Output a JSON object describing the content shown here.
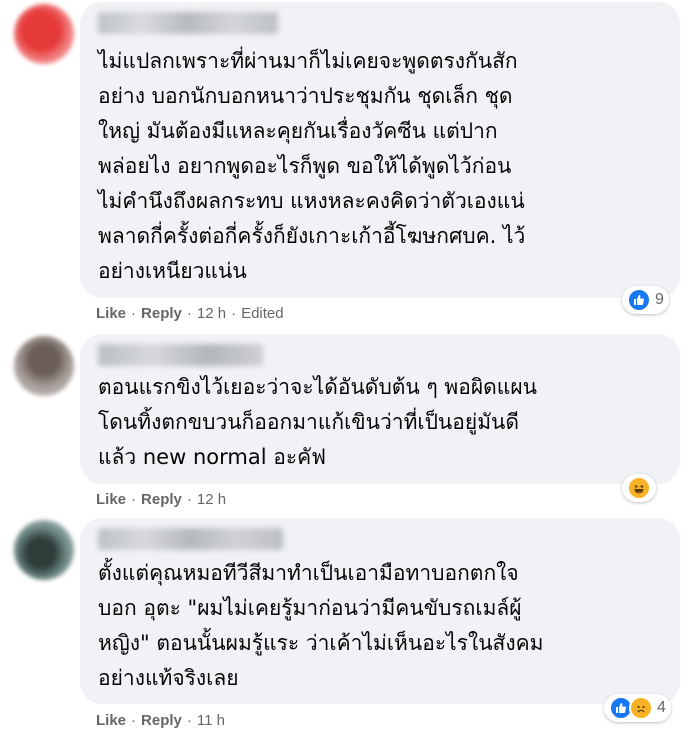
{
  "actions": {
    "like": "Like",
    "reply": "Reply",
    "separator": "·"
  },
  "comments": [
    {
      "text": "ไม่แปลกเพราะที่ผ่านมาก็ไม่เคยจะพูดตรงกันสัก\nอย่าง บอกนักบอกหนาว่าประชุมกัน ชุดเล็ก ชุด\nใหญ่ มันต้องมีแหละคุยกันเรื่องวัคซีน แต่ปาก\nพล่อยไง อยากพูดอะไรก็พูด ขอให้ได้พูดไว้ก่อน\nไม่คำนึงถึงผลกระทบ แหงหละคงคิดว่าตัวเองแน่\nพลาดกี่ครั้งต่อกี่ครั้งก็ยังเกาะเก้าอี้โฆษกศบค. ไว้\nอย่างเหนียวแน่น",
      "time": "12 h",
      "edited": "Edited",
      "reaction_count": "9",
      "reactions": [
        "like-icon"
      ]
    },
    {
      "text": "ตอนแรกขิงไว้เยอะว่าจะได้อันดับต้น ๆ พอผิดแผน\nโดนทิ้งตกขบวนก็ออกมาแก้เขินว่าที่เป็นอยู่มันดี\nแล้ว new normal อะคัฟ",
      "time": "12 h",
      "reactions": [
        "haha-icon"
      ]
    },
    {
      "text": "ตั้งแต่คุณหมอทีวีสีมาทำเป็นเอามือทาบอกตกใจ\nบอก อุตะ \"ผมไม่เคยรู้มาก่อนว่ามีคนขับรถเมล์ผู้\nหญิง\" ตอนนั้นผมรู้แระ ว่าเค้าไม่เห็นอะไรในสังคม\nอย่างแท้จริงเลย",
      "time": "11 h",
      "reaction_count": "4",
      "reactions": [
        "like-icon",
        "sad-icon"
      ]
    }
  ],
  "colors": {
    "like": "#1877f2",
    "emoji": "#f7b125",
    "meta": "#65676b",
    "bubble": "#f0f2f5"
  }
}
